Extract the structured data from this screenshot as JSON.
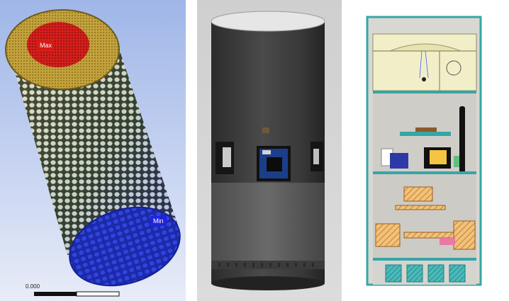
{
  "panels": [
    {
      "id": "fea-simulation",
      "max_label": "Max",
      "min_label": "Min",
      "scale_label": "0.000",
      "colors": {
        "background_top": "#9fb6e8",
        "background_bottom": "#e8ecf8",
        "max": "#e2231f",
        "mid": "#c8b04c",
        "min": "#1e2fd0",
        "mesh": "#2e3a2a"
      }
    },
    {
      "id": "cylinder-render",
      "colors": {
        "background": "#d6d6d6",
        "body": "#3a3a3a",
        "band": "#555555",
        "pcb": "#1c3e8a"
      }
    },
    {
      "id": "cross-section",
      "colors": {
        "outline": "#36a6a6",
        "wall": "#d9d7d2",
        "top_section": "#f2efc8",
        "hatch": "#e7a24a",
        "base": "#3aa8a8"
      }
    }
  ]
}
